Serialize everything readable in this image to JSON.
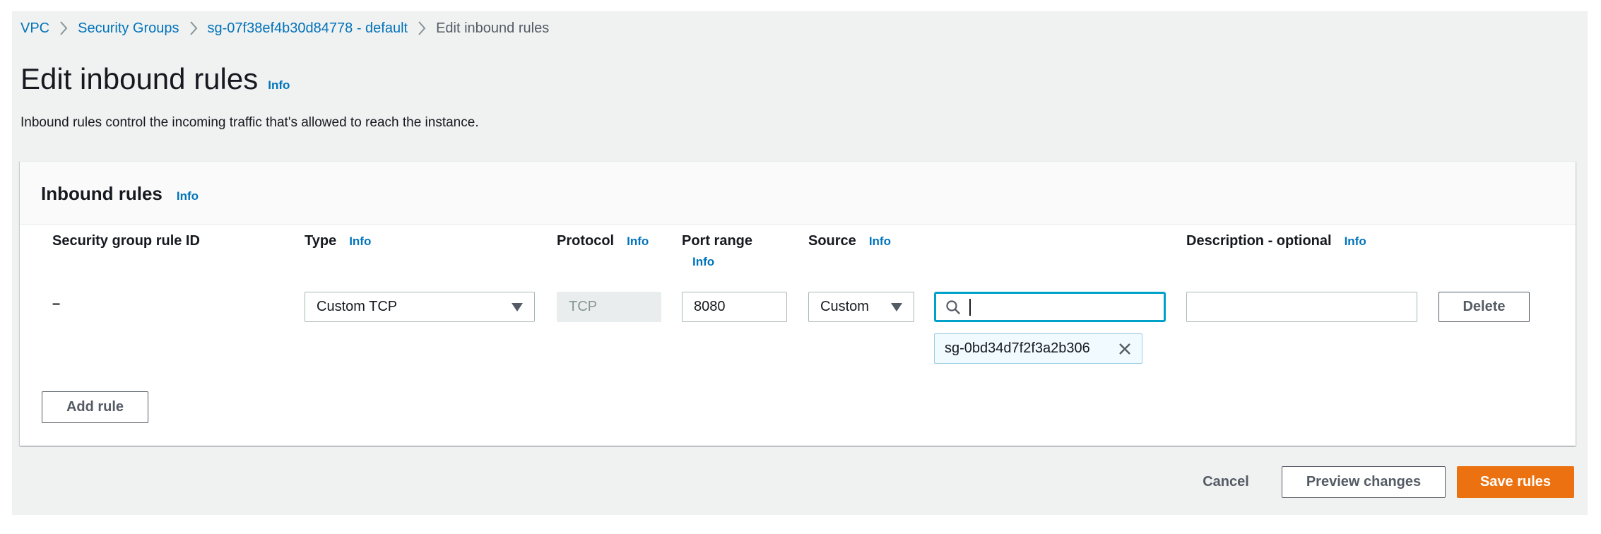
{
  "breadcrumb": {
    "items": [
      {
        "label": "VPC",
        "link": true
      },
      {
        "label": "Security Groups",
        "link": true
      },
      {
        "label": "sg-07f38ef4b30d84778 - default",
        "link": true
      },
      {
        "label": "Edit inbound rules",
        "link": false
      }
    ],
    "separator_icon": "chevron-right-icon"
  },
  "header": {
    "title": "Edit inbound rules",
    "info_label": "Info",
    "description": "Inbound rules control the incoming traffic that's allowed to reach the instance."
  },
  "panel": {
    "title": "Inbound rules",
    "info_label": "Info",
    "columns": [
      {
        "label": "Security group rule ID",
        "info": null
      },
      {
        "label": "Type",
        "info": "Info"
      },
      {
        "label": "Protocol",
        "info": "Info"
      },
      {
        "label": "Port range",
        "info": "Info"
      },
      {
        "label": "Source",
        "info": "Info"
      },
      {
        "label": "Description - optional",
        "info": "Info"
      }
    ],
    "rows": [
      {
        "rule_id": "–",
        "type": "Custom TCP",
        "protocol": "TCP",
        "port_range": "8080",
        "source_type": "Custom",
        "source_search_value": "",
        "source_tokens": [
          "sg-0bd34d7f2f3a2b306"
        ],
        "description": "",
        "delete_label": "Delete"
      }
    ],
    "add_rule_label": "Add rule"
  },
  "footer": {
    "cancel_label": "Cancel",
    "preview_label": "Preview changes",
    "save_label": "Save rules"
  },
  "colors": {
    "link": "#0073bb",
    "primary": "#ec7211",
    "focus": "#00a1c9",
    "page_bg": "#f0f1f1"
  }
}
